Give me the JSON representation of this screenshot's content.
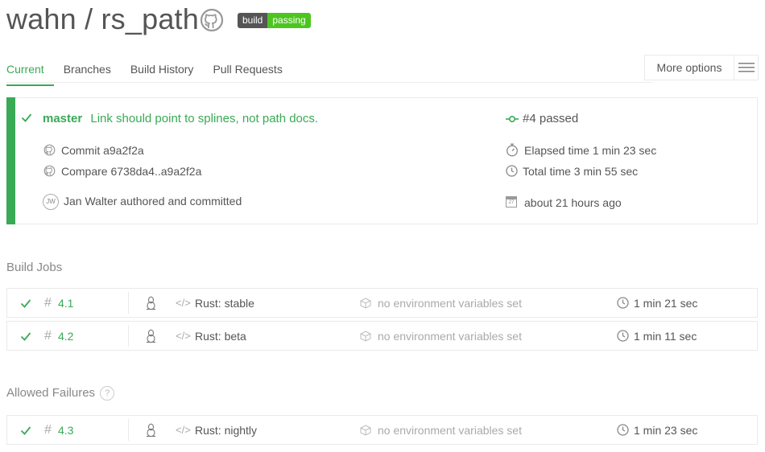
{
  "header": {
    "owner": "wahn",
    "separator": " / ",
    "repo": "rs_path",
    "badge": {
      "left": "build",
      "right": "passing"
    },
    "icon": "github-icon"
  },
  "tabs": [
    {
      "label": "Current",
      "active": true
    },
    {
      "label": "Branches",
      "active": false
    },
    {
      "label": "Build History",
      "active": false
    },
    {
      "label": "Pull Requests",
      "active": false
    }
  ],
  "more_options": {
    "label": "More options",
    "icon": "hamburger-icon"
  },
  "summary": {
    "branch": "master",
    "message": "Link should point to splines, not path docs.",
    "commit_label": "Commit a9a2f2a",
    "compare_label": "Compare 6738da4..a9a2f2a",
    "author_initials": "JW",
    "author_text": "Jan Walter authored and committed",
    "build_status": "#4 passed",
    "elapsed": "Elapsed time 1 min 23 sec",
    "total": "Total time 3 min 55 sec",
    "calendar_day": "27",
    "when": "about 21 hours ago",
    "status_color": "#39aa56"
  },
  "build_jobs": {
    "title": "Build Jobs",
    "jobs": [
      {
        "number": "4.1",
        "name": "Rust: stable",
        "env": "no environment variables set",
        "duration": "1 min 21 sec"
      },
      {
        "number": "4.2",
        "name": "Rust: beta",
        "env": "no environment variables set",
        "duration": "1 min 11 sec"
      }
    ]
  },
  "allowed_failures": {
    "title": "Allowed Failures",
    "help": "?",
    "jobs": [
      {
        "number": "4.3",
        "name": "Rust: nightly",
        "env": "no environment variables set",
        "duration": "1 min 23 sec"
      }
    ]
  }
}
